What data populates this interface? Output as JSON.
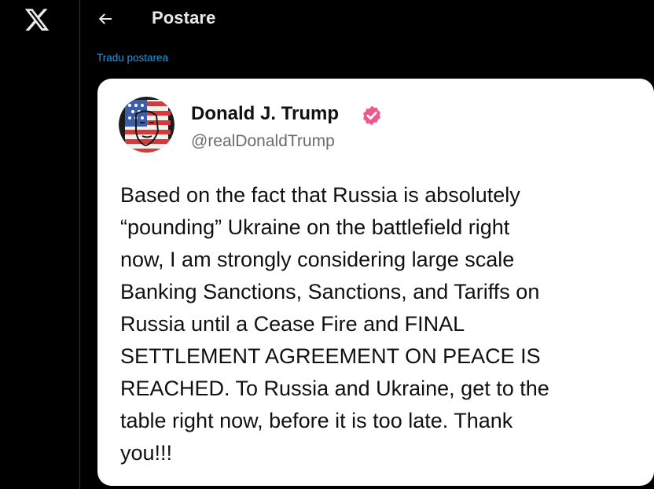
{
  "app": {
    "logo_icon": "x-logo-icon"
  },
  "header": {
    "back_icon": "arrow-left-icon",
    "title": "Postare"
  },
  "post": {
    "translate_label": "Tradu postarea",
    "author": {
      "name": "Donald J. Trump",
      "handle": "@realDonaldTrump",
      "verified_icon": "verified-badge-icon",
      "verified_color": "#f91880"
    },
    "text": "Based on the fact that Russia is absolutely\n“pounding” Ukraine on the battlefield right\nnow, I am strongly considering large scale\nBanking Sanctions, Sanctions, and Tariffs on\nRussia until a Cease Fire and FINAL\nSETTLEMENT AGREEMENT ON PEACE IS\nREACHED. To Russia and Ukraine, get to the\ntable right now, before it is too late. Thank\nyou!!!"
  },
  "colors": {
    "background": "#000000",
    "link": "#1d9bf0",
    "card": "#ffffff",
    "title_text": "#e7e9ea",
    "handle_text": "#6b6b6b"
  }
}
